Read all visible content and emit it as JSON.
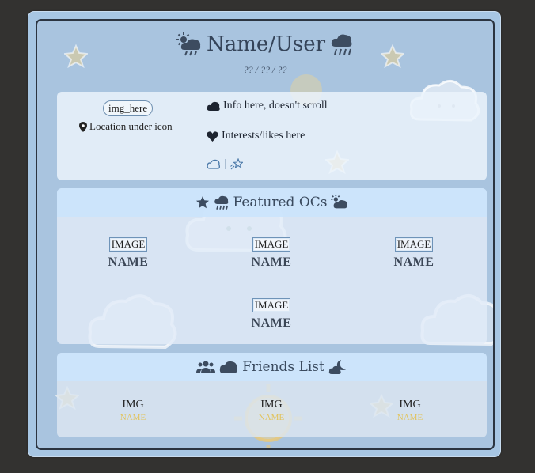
{
  "header": {
    "title": "Name/User",
    "date": "?? / ?? / ??"
  },
  "profile": {
    "image_placeholder": "img_here",
    "location": "Location under icon",
    "info": "Info here, doesn't scroll",
    "interests": "Interests/likes here",
    "separator": "|"
  },
  "featured": {
    "title": "Featured OCs",
    "ocs": [
      {
        "image": "IMAGE",
        "name": "NAME"
      },
      {
        "image": "IMAGE",
        "name": "NAME"
      },
      {
        "image": "IMAGE",
        "name": "NAME"
      },
      {
        "image": "IMAGE",
        "name": "NAME"
      }
    ]
  },
  "friends": {
    "title": "Friends List",
    "items": [
      {
        "image": "IMG",
        "name": "NAME"
      },
      {
        "image": "IMG",
        "name": "NAME"
      },
      {
        "image": "IMG",
        "name": "NAME"
      }
    ]
  },
  "colors": {
    "background": "#333230",
    "frame": "#a7c6e3",
    "section_header": "#cbe4fc",
    "friend_name": "#e2c35c",
    "title_text": "#354459"
  },
  "icons": [
    "sun-cloud-rain-icon",
    "cloud-rain-icon",
    "map-pin-icon",
    "cloud-icon",
    "heart-icon",
    "cloud-outline-icon",
    "shooting-star-icon",
    "star-icon",
    "users-icon",
    "moon-cloud-icon"
  ]
}
